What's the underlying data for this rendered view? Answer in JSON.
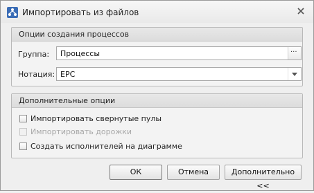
{
  "window": {
    "title": "Импортировать из файлов",
    "icon": "process-network-icon",
    "close": "close-icon"
  },
  "process_options": {
    "title": "Опции создания процессов",
    "group_label": "Группа:",
    "group_value": "Процессы",
    "group_browse": "···",
    "notation_label": "Нотация:",
    "notation_value": "EPC",
    "notation_dropdown_icon": "chevron-down-icon"
  },
  "additional_options": {
    "title": "Дополнительные опции",
    "items": [
      {
        "label": "Импортировать свернутые пулы",
        "checked": false,
        "enabled": true
      },
      {
        "label": "Импортировать дорожки",
        "checked": false,
        "enabled": false
      },
      {
        "label": "Создать исполнителей на диаграмме",
        "checked": false,
        "enabled": true
      }
    ]
  },
  "buttons": {
    "ok": "ОК",
    "cancel": "Отмена",
    "more": "Дополнительно <<"
  }
}
